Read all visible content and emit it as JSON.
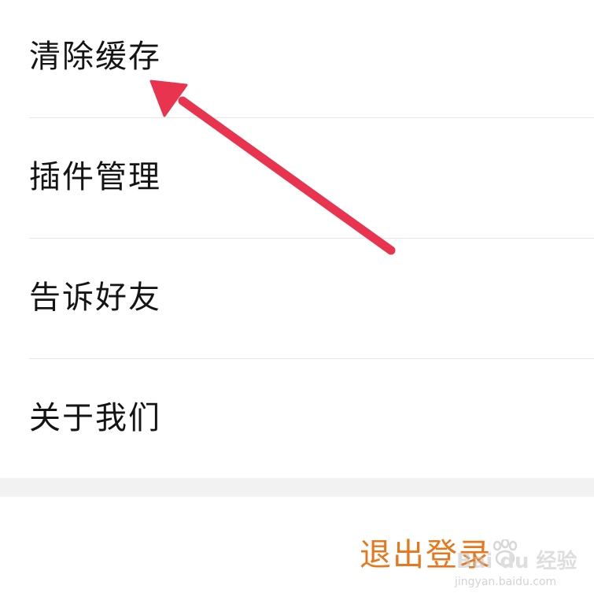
{
  "menu": {
    "items": [
      {
        "label": "清除缓存"
      },
      {
        "label": "插件管理"
      },
      {
        "label": "告诉好友"
      },
      {
        "label": "关于我们"
      }
    ]
  },
  "logout": {
    "label": "退出登录"
  },
  "annotation": {
    "icon": "arrow-icon",
    "color": "#e8344e"
  },
  "watermark": {
    "brand": "Bai du 经验",
    "site": "jingyan.baidu.com"
  },
  "colors": {
    "accent": "#e8761a",
    "text": "#141414",
    "divider": "#e6e6e6",
    "band": "#f2f2f2"
  }
}
